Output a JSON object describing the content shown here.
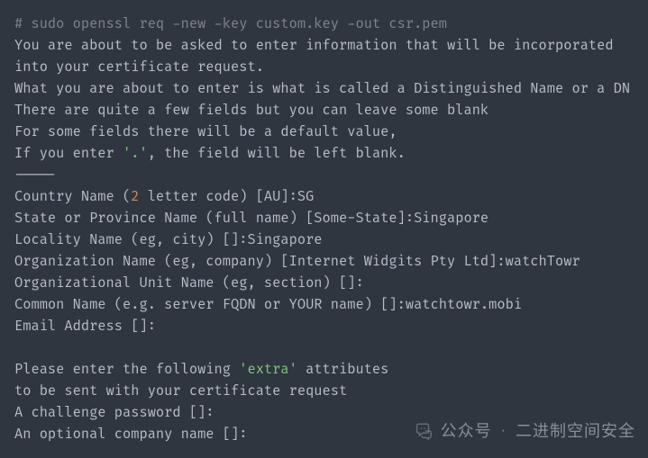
{
  "terminal": {
    "command_line": "# sudo openssl req -new -key custom.key -out csr.pem",
    "intro": {
      "l1": "You are about to be asked to enter information that will be incorporated",
      "l2": "into your certificate request.",
      "l3": "What you are about to enter is what is called a Distinguished Name or a DN",
      "l4": "There are quite a few fields but you can leave some blank",
      "l5": "For some fields there will be a default value,",
      "l6a": "If you enter ",
      "l6b": "'.'",
      "l6c": ", the field will be left blank.",
      "sep": "-----"
    },
    "fields": {
      "country_pre": "Country Name (",
      "country_num": "2",
      "country_post": " letter code) [AU]:SG",
      "state": "State or Province Name (full name) [Some-State]:Singapore",
      "locality": "Locality Name (eg, city) []:Singapore",
      "org": "Organization Name (eg, company) [Internet Widgits Pty Ltd]:watchTowr",
      "ou": "Organizational Unit Name (eg, section) []:",
      "cn": "Common Name (e.g. server FQDN or YOUR name) []:watchtowr.mobi",
      "email": "Email Address []:"
    },
    "extra": {
      "blank": "",
      "l1a": "Please enter the following ",
      "l1b": "'extra'",
      "l1c": " attributes",
      "l2": "to be sent with your certificate request",
      "challenge": "A challenge password []:",
      "optcompany": "An optional company name []:"
    }
  },
  "watermark": {
    "label": "公众号",
    "dot": "·",
    "account": "二进制空间安全"
  }
}
